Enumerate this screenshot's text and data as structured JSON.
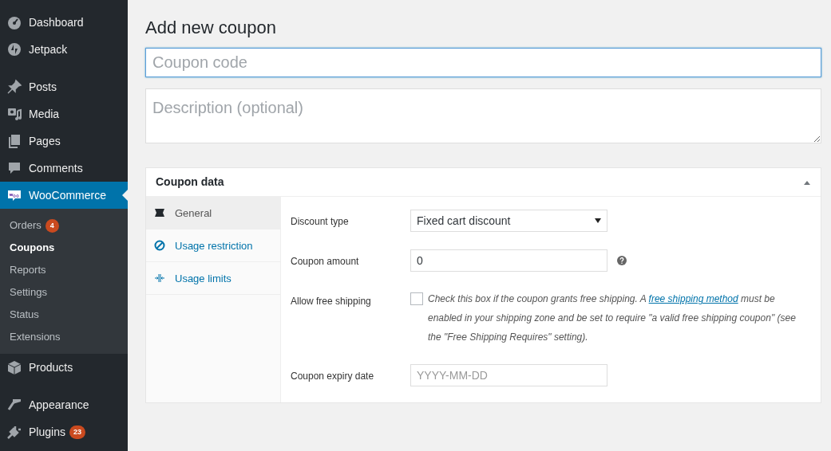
{
  "sidebar": {
    "groups": [
      [
        {
          "label": "Dashboard",
          "selected": false
        },
        {
          "label": "Jetpack",
          "selected": false
        }
      ],
      [
        {
          "label": "Posts",
          "selected": false
        },
        {
          "label": "Media",
          "selected": false
        },
        {
          "label": "Pages",
          "selected": false
        },
        {
          "label": "Comments",
          "selected": false
        },
        {
          "label": "WooCommerce",
          "selected": true,
          "children": [
            {
              "label": "Orders",
              "selected": false,
              "badge": "4"
            },
            {
              "label": "Coupons",
              "selected": true
            },
            {
              "label": "Reports",
              "selected": false
            },
            {
              "label": "Settings",
              "selected": false
            },
            {
              "label": "Status",
              "selected": false
            },
            {
              "label": "Extensions",
              "selected": false
            }
          ]
        },
        {
          "label": "Products",
          "selected": false
        }
      ],
      [
        {
          "label": "Appearance",
          "selected": false
        },
        {
          "label": "Plugins",
          "selected": false,
          "badge": "23"
        }
      ]
    ]
  },
  "page_title": "Add new coupon",
  "code_field": {
    "placeholder": "Coupon code",
    "focused": true
  },
  "description_field": {
    "placeholder": "Description (optional)"
  },
  "panel": {
    "title": "Coupon data",
    "expanded": true,
    "tabs": [
      {
        "label": "General",
        "selected": true
      },
      {
        "label": "Usage restriction",
        "selected": false
      },
      {
        "label": "Usage limits",
        "selected": false
      }
    ],
    "fields": [
      {
        "kind": "select",
        "label": "Discount type",
        "value": "Fixed cart discount"
      },
      {
        "kind": "text",
        "label": "Coupon amount",
        "value": "0",
        "help": true
      },
      {
        "kind": "checkbox",
        "label": "Allow free shipping",
        "checked": false,
        "description": {
          "before": "Check this box if the coupon grants free shipping. A ",
          "link": "free shipping method",
          "after": " must be enabled in your shipping zone and be set to require \"a valid free shipping coupon\" (see the \"Free Shipping Requires\" setting)."
        }
      },
      {
        "kind": "text",
        "label": "Coupon expiry date",
        "placeholder": "YYYY-MM-DD"
      }
    ]
  }
}
